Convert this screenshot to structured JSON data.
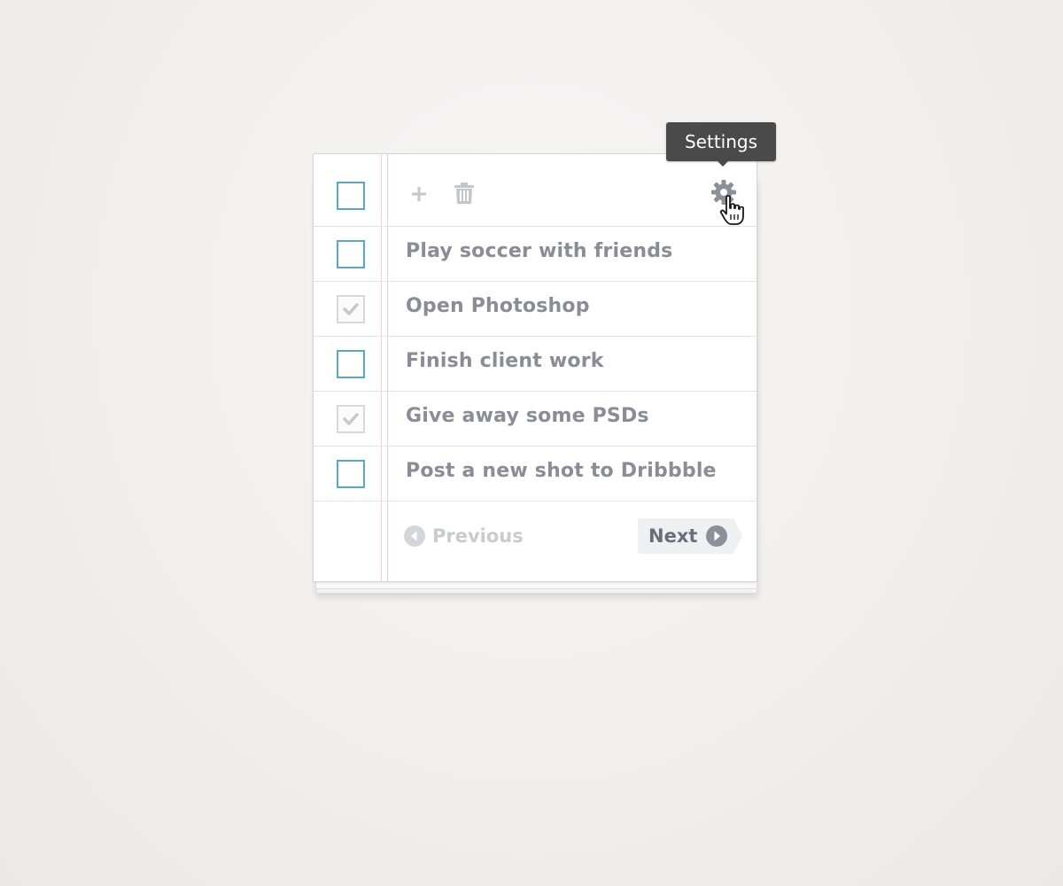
{
  "toolbar": {
    "add_icon": "plus-icon",
    "delete_icon": "trash-icon",
    "settings_icon": "gear-icon",
    "tooltip": "Settings"
  },
  "select_all": {
    "checked": false
  },
  "tasks": [
    {
      "label": "Play soccer with friends",
      "checked": false
    },
    {
      "label": "Open Photoshop",
      "checked": true
    },
    {
      "label": "Finish client work",
      "checked": false
    },
    {
      "label": "Give away some PSDs",
      "checked": true
    },
    {
      "label": "Post a new shot to Dribbble",
      "checked": false
    }
  ],
  "pager": {
    "previous_label": "Previous",
    "next_label": "Next",
    "previous_enabled": false
  },
  "colors": {
    "checkbox_border": "#58a9c1",
    "checked_border": "#d8d8d8",
    "label_text": "#8a8c97",
    "tooltip_bg": "#4a4a4a"
  }
}
